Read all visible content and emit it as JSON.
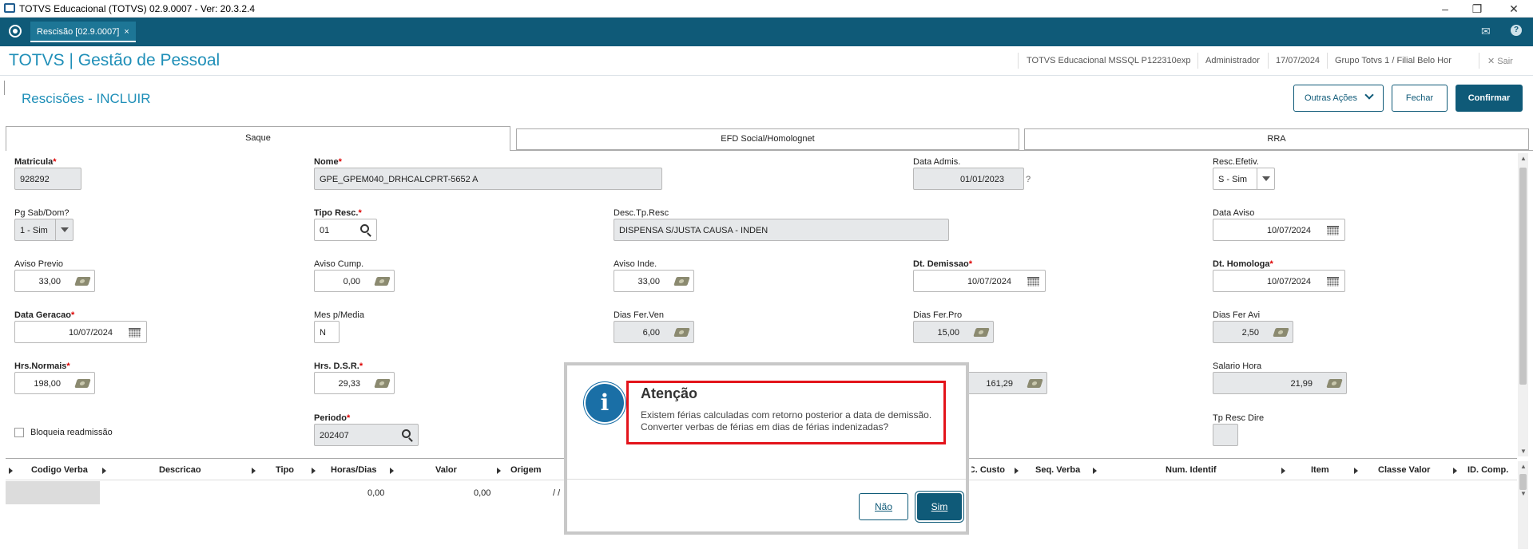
{
  "window": {
    "title": "TOTVS Educacional (TOTVS) 02.9.0007 - Ver: 20.3.2.4"
  },
  "tabbar": {
    "tab_label": "Rescisão [02.9.0007]",
    "tab_close": "×"
  },
  "header": {
    "brand": "TOTVS | Gestão de Pessoal",
    "environment": "TOTVS Educacional MSSQL P122310exp",
    "user": "Administrador",
    "date": "17/07/2024",
    "branch": "Grupo Totvs 1 / Filial Belo Hor",
    "exit_label": "Sair"
  },
  "page": {
    "title": "Rescisões - INCLUIR",
    "other_actions": "Outras Ações",
    "close": "Fechar",
    "confirm": "Confirmar"
  },
  "folders": [
    "Saque",
    "EFD Social/Homolognet",
    "RRA"
  ],
  "form": {
    "matricula": {
      "label": "Matricula",
      "value": "928292"
    },
    "nome": {
      "label": "Nome",
      "value": "GPE_GPEM040_DRHCALCPRT-5652 A"
    },
    "data_admis": {
      "label": "Data Admis.",
      "value": "01/01/2023",
      "help": "?"
    },
    "resc_efetiv": {
      "label": "Resc.Efetiv.",
      "value": "S - Sim"
    },
    "pg_sab_dom": {
      "label": "Pg Sab/Dom?",
      "value": "1 - Sim"
    },
    "tipo_resc": {
      "label": "Tipo Resc.",
      "value": "01"
    },
    "desc_tp_resc": {
      "label": "Desc.Tp.Resc",
      "value": "DISPENSA S/JUSTA CAUSA - INDEN"
    },
    "data_aviso": {
      "label": "Data Aviso",
      "value": "10/07/2024"
    },
    "aviso_previo": {
      "label": "Aviso Previo",
      "value": "33,00"
    },
    "aviso_cump": {
      "label": "Aviso Cump.",
      "value": "0,00"
    },
    "aviso_inde": {
      "label": "Aviso Inde.",
      "value": "33,00"
    },
    "dt_demissao": {
      "label": "Dt. Demissao",
      "value": "10/07/2024"
    },
    "dt_homologa": {
      "label": "Dt. Homologa",
      "value": "10/07/2024"
    },
    "data_geracao": {
      "label": "Data Geracao",
      "value": "10/07/2024"
    },
    "mes_media": {
      "label": "Mes p/Media",
      "value": "N"
    },
    "dias_fer_ven": {
      "label": "Dias Fer.Ven",
      "value": "6,00"
    },
    "dias_fer_pro": {
      "label": "Dias Fer.Pro",
      "value": "15,00"
    },
    "dias_fer_avi": {
      "label": "Dias Fer Avi",
      "value": "2,50"
    },
    "hrs_normais": {
      "label": "Hrs.Normais",
      "value": "198,00"
    },
    "hrs_dsr": {
      "label": "Hrs. D.S.R.",
      "value": "29,33"
    },
    "hidden_value": {
      "value": "161,29"
    },
    "salario_hora": {
      "label": "Salario Hora",
      "value": "21,99"
    },
    "bloqueia": {
      "label": "Bloqueia readmissão"
    },
    "periodo": {
      "label": "Periodo",
      "value": "202407"
    },
    "tp_resc_dire": {
      "label": "Tp Resc Dire"
    }
  },
  "grid": {
    "columns": [
      "Codigo Verba",
      "Descricao",
      "Tipo",
      "Horas/Dias",
      "Valor",
      "Origem",
      "C. Custo",
      "Seq. Verba",
      "Num. Identif",
      "Item",
      "Classe Valor",
      "ID. Comp."
    ],
    "row": {
      "horas": "0,00",
      "valor": "0,00",
      "origem": "/ /"
    }
  },
  "dialog": {
    "title": "Atenção",
    "line1": "Existem férias calculadas com retorno posterior a data de demissão.",
    "line2": "Converter verbas de férias em dias de férias indenizadas?",
    "no": "Não",
    "yes": "Sim",
    "info_glyph": "i"
  }
}
